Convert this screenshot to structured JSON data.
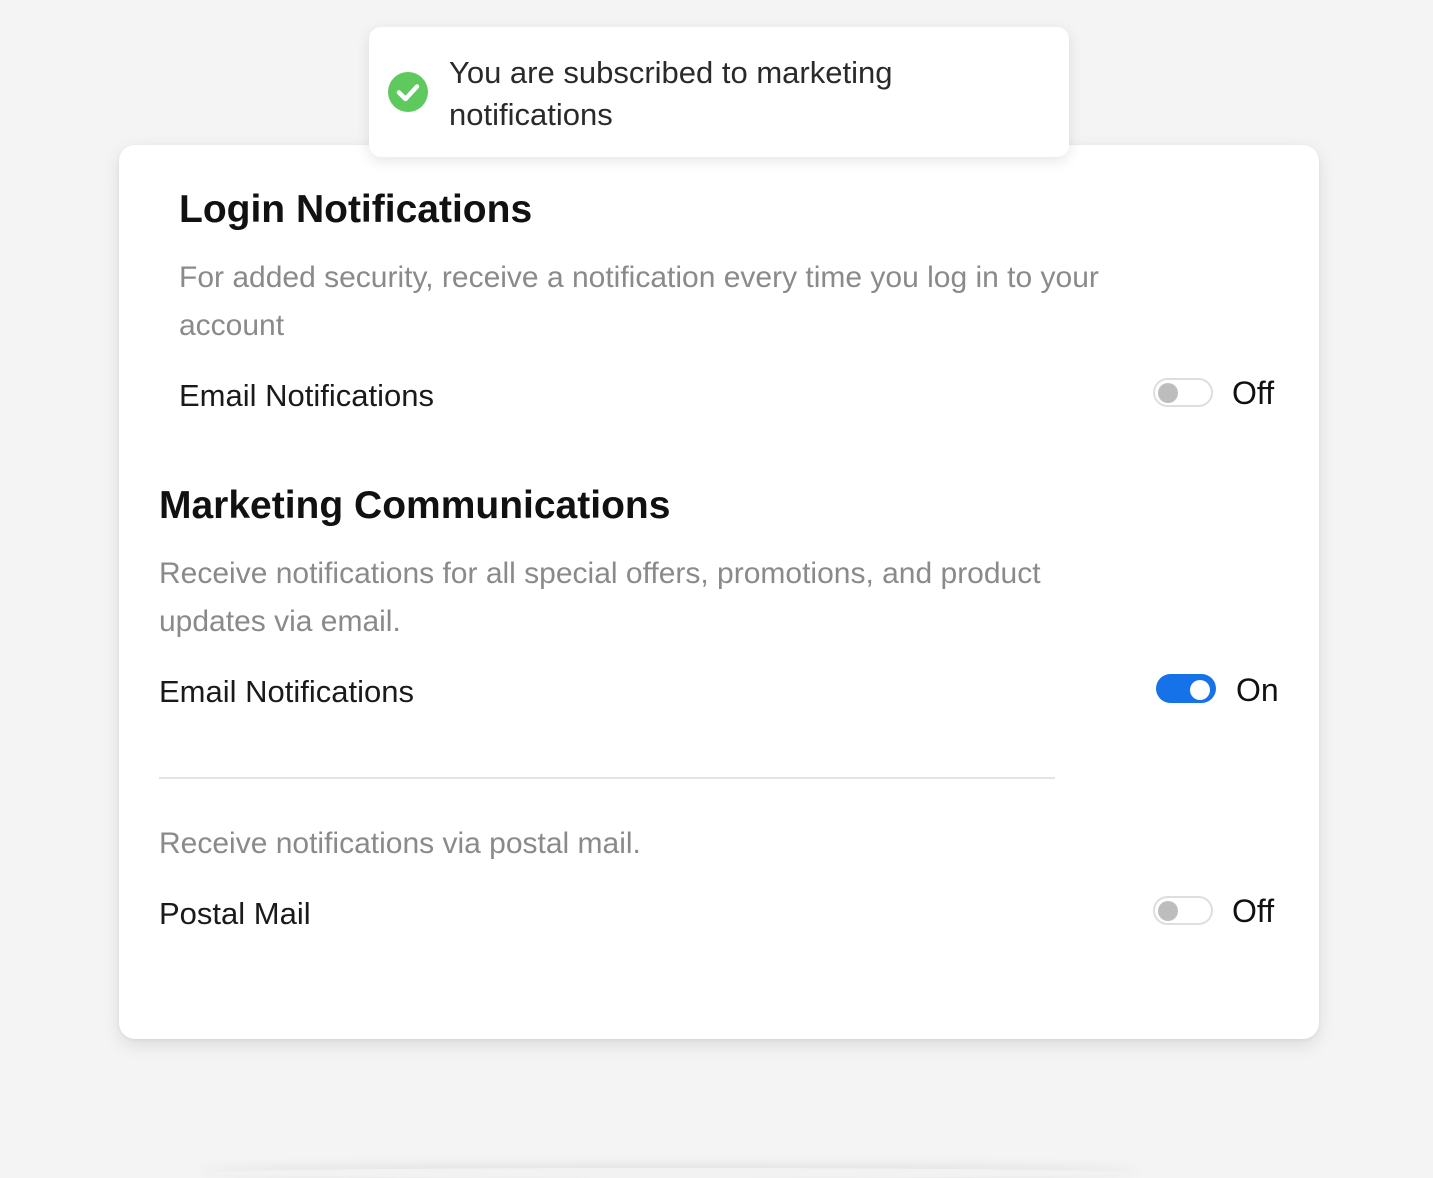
{
  "toast": {
    "message": "You are subscribed to marketing notifications",
    "icon": "check-circle-icon",
    "icon_color": "#5ec95d"
  },
  "login": {
    "title": "Login Notifications",
    "description": "For added security, receive a notification every time you log in to your account",
    "email": {
      "label": "Email Notifications",
      "enabled": false,
      "state_label": "Off"
    }
  },
  "marketing": {
    "title": "Marketing Communications",
    "description": "Receive notifications for all special offers, promotions, and product updates via email.",
    "email": {
      "label": "Email Notifications",
      "enabled": true,
      "state_label": "On"
    },
    "postal_description": "Receive notifications via postal mail.",
    "postal": {
      "label": "Postal Mail",
      "enabled": false,
      "state_label": "Off"
    }
  },
  "colors": {
    "toggle_on": "#1672e8",
    "toggle_off_knob": "#bdbdbd",
    "description_text": "#8a8a8a",
    "background": "#f4f4f4"
  }
}
